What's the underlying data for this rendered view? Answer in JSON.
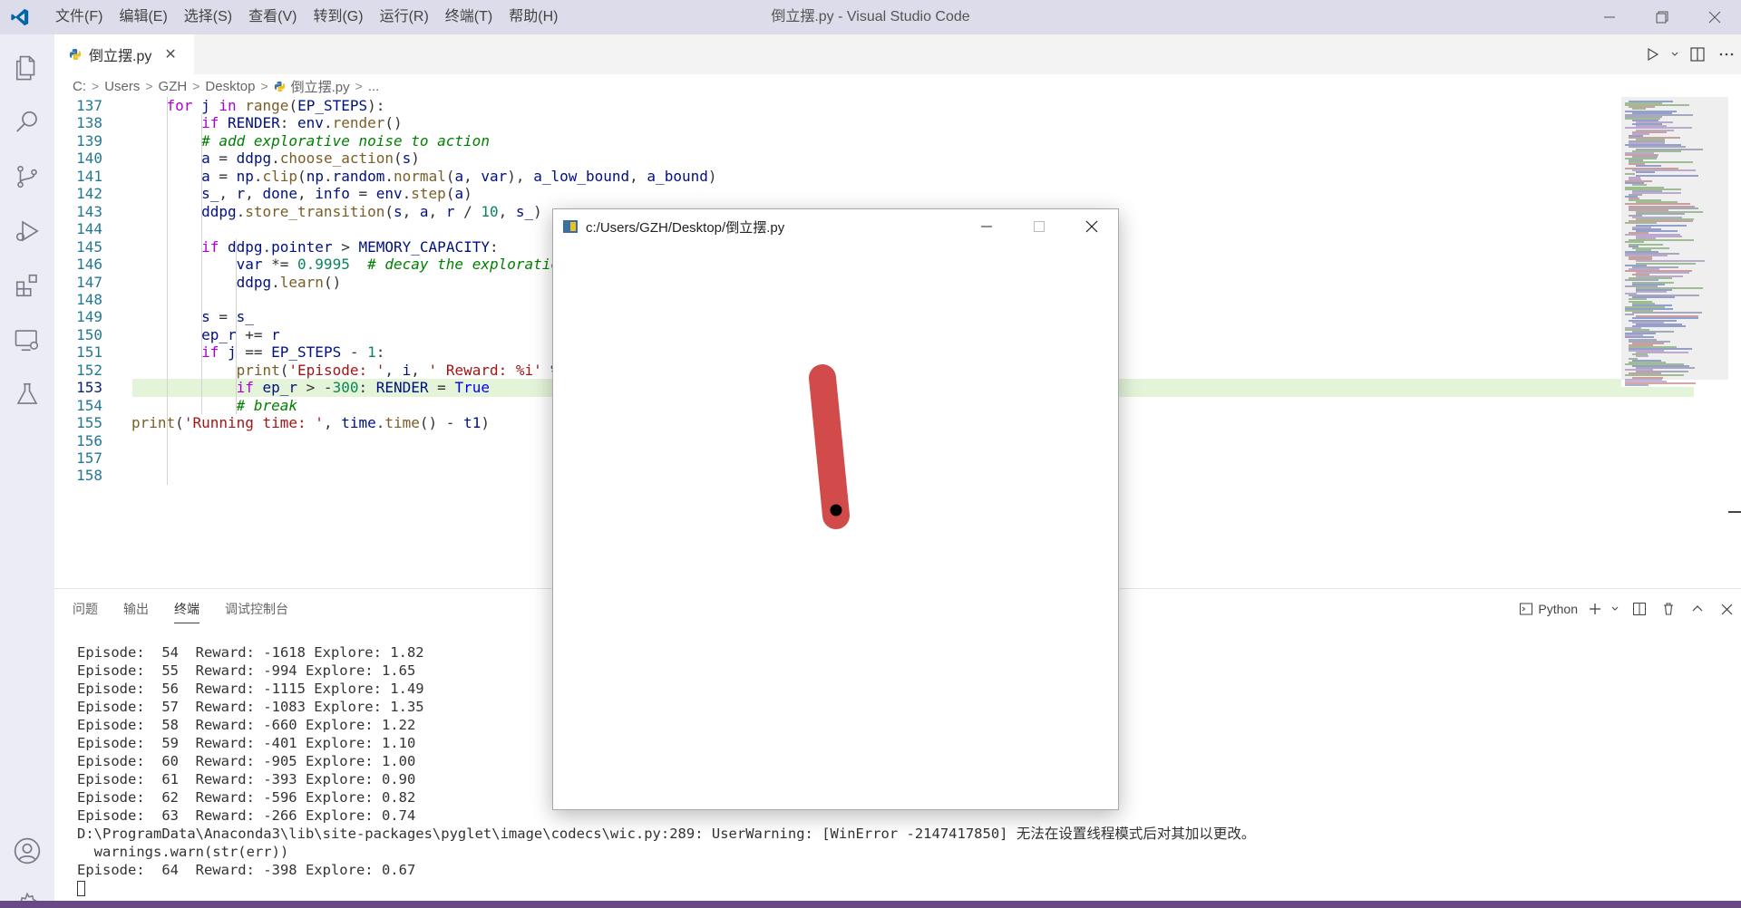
{
  "window": {
    "title": "倒立摆.py - Visual Studio Code",
    "menu": [
      "文件(F)",
      "编辑(E)",
      "选择(S)",
      "查看(V)",
      "转到(G)",
      "运行(R)",
      "终端(T)",
      "帮助(H)"
    ]
  },
  "activity_bar": [
    "explorer-icon",
    "search-icon",
    "source-control-icon",
    "run-debug-icon",
    "extensions-icon",
    "remote-explorer-icon",
    "testing-icon",
    "account-icon",
    "manage-gear-icon"
  ],
  "tabs": [
    {
      "label": "倒立摆.py",
      "close": "✕"
    }
  ],
  "breadcrumb": [
    "C:",
    "Users",
    "GZH",
    "Desktop",
    "倒立摆.py",
    "..."
  ],
  "editor": {
    "active_line": 153,
    "lines": [
      {
        "n": "137",
        "text": "    for j in range(EP_STEPS):"
      },
      {
        "n": "138",
        "text": "        if RENDER: env.render()"
      },
      {
        "n": "139",
        "text": "        # add explorative noise to action"
      },
      {
        "n": "140",
        "text": "        a = ddpg.choose_action(s)"
      },
      {
        "n": "141",
        "text": "        a = np.clip(np.random.normal(a, var), a_low_bound, a_bound)"
      },
      {
        "n": "142",
        "text": "        s_, r, done, info = env.step(a)"
      },
      {
        "n": "143",
        "text": "        ddpg.store_transition(s, a, r / 10, s_)"
      },
      {
        "n": "144",
        "text": ""
      },
      {
        "n": "145",
        "text": "        if ddpg.pointer > MEMORY_CAPACITY:"
      },
      {
        "n": "146",
        "text": "            var *= 0.9995  # decay the exploration"
      },
      {
        "n": "147",
        "text": "            ddpg.learn()"
      },
      {
        "n": "148",
        "text": ""
      },
      {
        "n": "149",
        "text": "        s = s_"
      },
      {
        "n": "150",
        "text": "        ep_r += r"
      },
      {
        "n": "151",
        "text": "        if j == EP_STEPS - 1:"
      },
      {
        "n": "152",
        "text": "            print('Episode: ', i, ' Reward: %i' %"
      },
      {
        "n": "153",
        "text": "            if ep_r > -300: RENDER = True"
      },
      {
        "n": "154",
        "text": "            # break"
      },
      {
        "n": "155",
        "text": "print('Running time: ', time.time() - t1)"
      },
      {
        "n": "156",
        "text": ""
      },
      {
        "n": "157",
        "text": ""
      },
      {
        "n": "158",
        "text": ""
      }
    ]
  },
  "panel": {
    "tabs": [
      "问题",
      "输出",
      "终端",
      "调试控制台"
    ],
    "active_tab": "终端",
    "shell": "Python",
    "terminal_lines": [
      "Episode:  54  Reward: -1618 Explore: 1.82",
      "Episode:  55  Reward: -994 Explore: 1.65",
      "Episode:  56  Reward: -1115 Explore: 1.49",
      "Episode:  57  Reward: -1083 Explore: 1.35",
      "Episode:  58  Reward: -660 Explore: 1.22",
      "Episode:  59  Reward: -401 Explore: 1.10",
      "Episode:  60  Reward: -905 Explore: 1.00",
      "Episode:  61  Reward: -393 Explore: 0.90",
      "Episode:  62  Reward: -596 Explore: 0.82",
      "Episode:  63  Reward: -266 Explore: 0.74",
      "D:\\ProgramData\\Anaconda3\\lib\\site-packages\\pyglet\\image\\codecs\\wic.py:289: UserWarning: [WinError -2147417850] 无法在设置线程模式后对其加以更改。",
      "  warnings.warn(str(err))",
      "Episode:  64  Reward: -398 Explore: 0.67"
    ]
  },
  "pyglet_window": {
    "title": "c:/Users/GZH/Desktop/倒立摆.py",
    "pendulum_color": "#d14b4b",
    "pivot_color": "#000000"
  },
  "colors": {
    "titlebar": "#dddceb",
    "activitybar": "#ececf4",
    "statusbar": "#6a4a86",
    "active_line": "#e4f4d9",
    "vscode_blue": "#0065a9"
  }
}
